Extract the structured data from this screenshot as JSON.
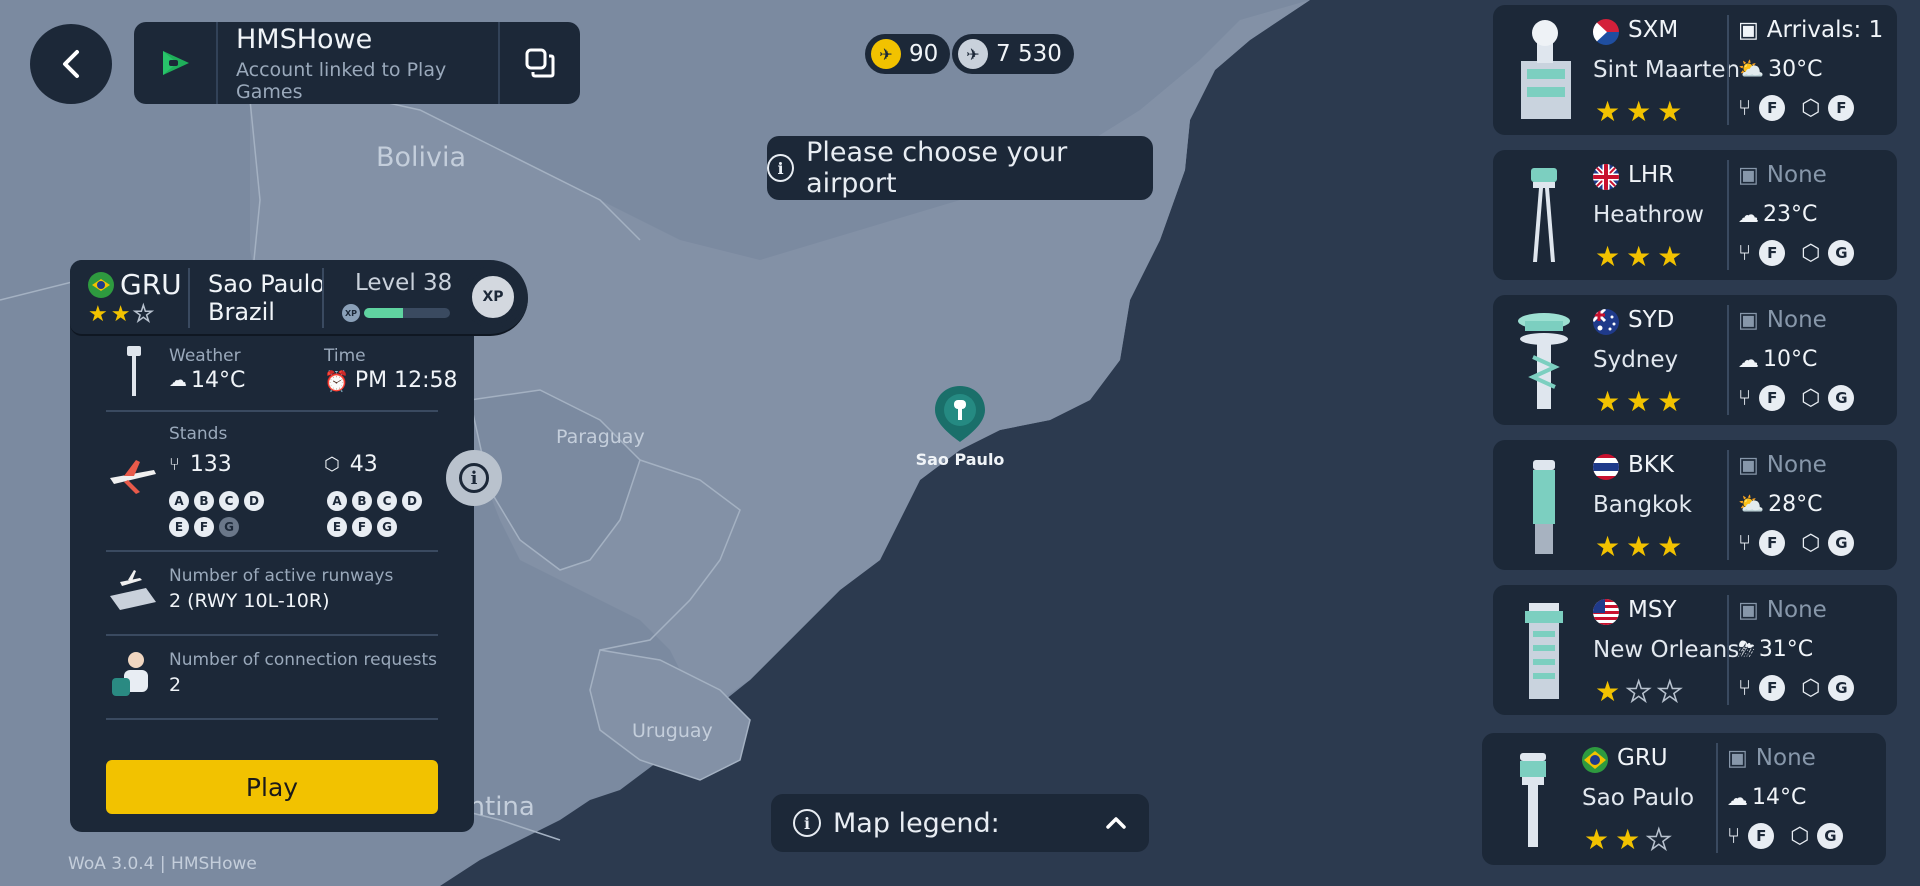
{
  "account": {
    "name": "HMSHowe",
    "subtitle": "Account linked to Play Games"
  },
  "currency": [
    {
      "icon": "coin-icon",
      "value": "90",
      "color": "#f2c200"
    },
    {
      "icon": "plane-coin-icon",
      "value": "7 530",
      "color": "#c9d1db"
    }
  ],
  "prompt": "Please choose your airport",
  "map": {
    "labels": {
      "bolivia": "Bolivia",
      "paraguay": "Paraguay",
      "uruguay": "Uruguay",
      "argentina": "Argentina"
    },
    "pin_label": "Sao Paulo"
  },
  "legend": {
    "label": "Map legend:"
  },
  "detail": {
    "code": "GRU",
    "city": "Sao Paulo",
    "country": "Brazil",
    "stars": 2,
    "level_label": "Level 38",
    "xp_label": "XP",
    "xp_progress": 0.45,
    "weather_label": "Weather",
    "weather_value": "14°C",
    "time_label": "Time",
    "time_value": "PM 12:58",
    "stands_label": "Stands",
    "passenger_stands": "133",
    "cargo_stands": "43",
    "passenger_classes": [
      "A",
      "B",
      "C",
      "D",
      "E",
      "F",
      "G"
    ],
    "cargo_classes": [
      "A",
      "B",
      "C",
      "D",
      "E",
      "F",
      "G"
    ],
    "runways_label": "Number of active runways",
    "runways_value": "2 (RWY 10L-10R)",
    "connections_label": "Number of connection requests",
    "connections_value": "2",
    "play_label": "Play"
  },
  "airports": [
    {
      "code": "SXM",
      "city": "Sint Maarten",
      "stars": 3,
      "arrivals": "Arrivals: 1",
      "temp": "30°C",
      "weather_icon": "sun-cloud-icon",
      "pax_class": "F",
      "cargo_class": "F",
      "flag": "sxm"
    },
    {
      "code": "LHR",
      "city": "Heathrow",
      "stars": 3,
      "arrivals": "None",
      "temp": "23°C",
      "weather_icon": "cloud-icon",
      "pax_class": "F",
      "cargo_class": "G",
      "flag": "uk"
    },
    {
      "code": "SYD",
      "city": "Sydney",
      "stars": 3,
      "arrivals": "None",
      "temp": "10°C",
      "weather_icon": "cloud-icon",
      "pax_class": "F",
      "cargo_class": "G",
      "flag": "au"
    },
    {
      "code": "BKK",
      "city": "Bangkok",
      "stars": 3,
      "arrivals": "None",
      "temp": "28°C",
      "weather_icon": "sun-cloud-icon",
      "pax_class": "F",
      "cargo_class": "G",
      "flag": "th"
    },
    {
      "code": "MSY",
      "city": "New Orleans",
      "stars": 1,
      "arrivals": "None",
      "temp": "31°C",
      "weather_icon": "storm-icon",
      "pax_class": "F",
      "cargo_class": "G",
      "flag": "us"
    },
    {
      "code": "GRU",
      "city": "Sao Paulo",
      "stars": 2,
      "arrivals": "None",
      "temp": "14°C",
      "weather_icon": "cloud-icon",
      "pax_class": "F",
      "cargo_class": "G",
      "flag": "br"
    }
  ],
  "version": "WoA 3.0.4 | HMSHowe",
  "colors": {
    "panel": "#1c2838",
    "ocean": "#2c3a4f",
    "land": "#7b8aa0",
    "accent_yellow": "#f2c200",
    "accent_teal": "#2a8a82"
  }
}
